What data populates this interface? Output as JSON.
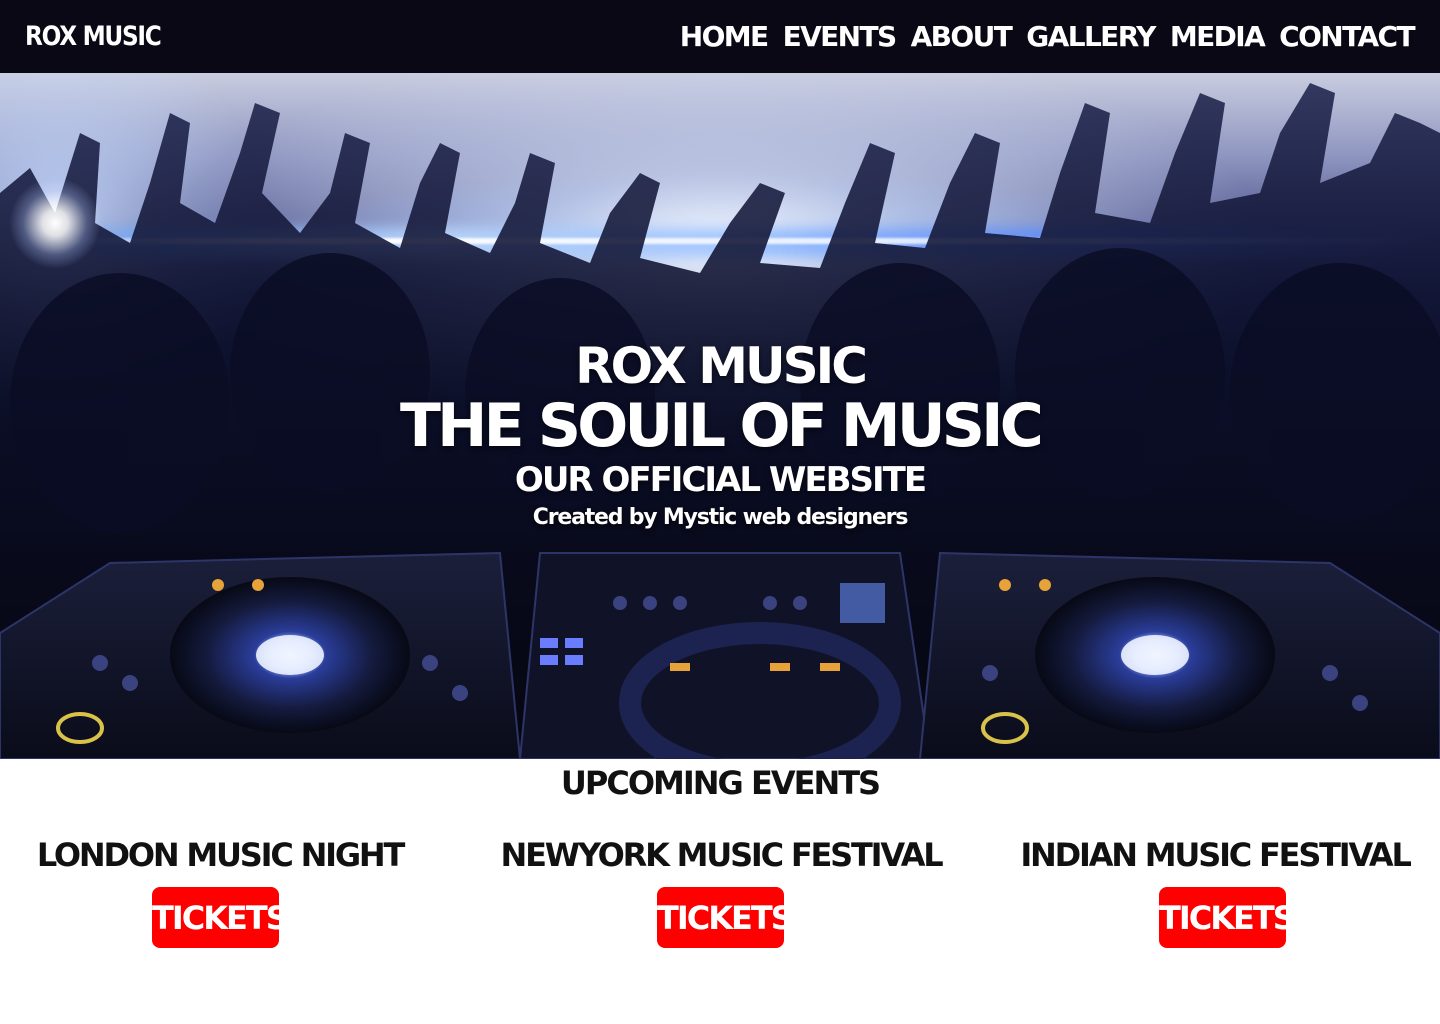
{
  "navbar": {
    "brand": "ROX MUSIC",
    "links": [
      {
        "label": "HOME"
      },
      {
        "label": "EVENTS"
      },
      {
        "label": "ABOUT"
      },
      {
        "label": "GALLERY"
      },
      {
        "label": "MEDIA"
      },
      {
        "label": "CONTACT"
      }
    ]
  },
  "hero": {
    "title": "ROX MUSIC",
    "subtitle": "THE SOUIL OF MUSIC",
    "tagline": "OUR OFFICIAL WEBSITE",
    "credit": "Created by Mystic web designers"
  },
  "events": {
    "heading": "UPCOMING EVENTS",
    "items": [
      {
        "name": "LONDON MUSIC NIGHT",
        "button_label": "TICKETS"
      },
      {
        "name": "NEWYORK MUSIC FESTIVAL",
        "button_label": "TICKETS"
      },
      {
        "name": "INDIAN MUSIC FESTIVAL",
        "button_label": "TICKETS"
      }
    ]
  },
  "colors": {
    "navbar_bg": "#090814",
    "button_bg": "#ff0000",
    "accent_blue": "#3b6bff"
  }
}
